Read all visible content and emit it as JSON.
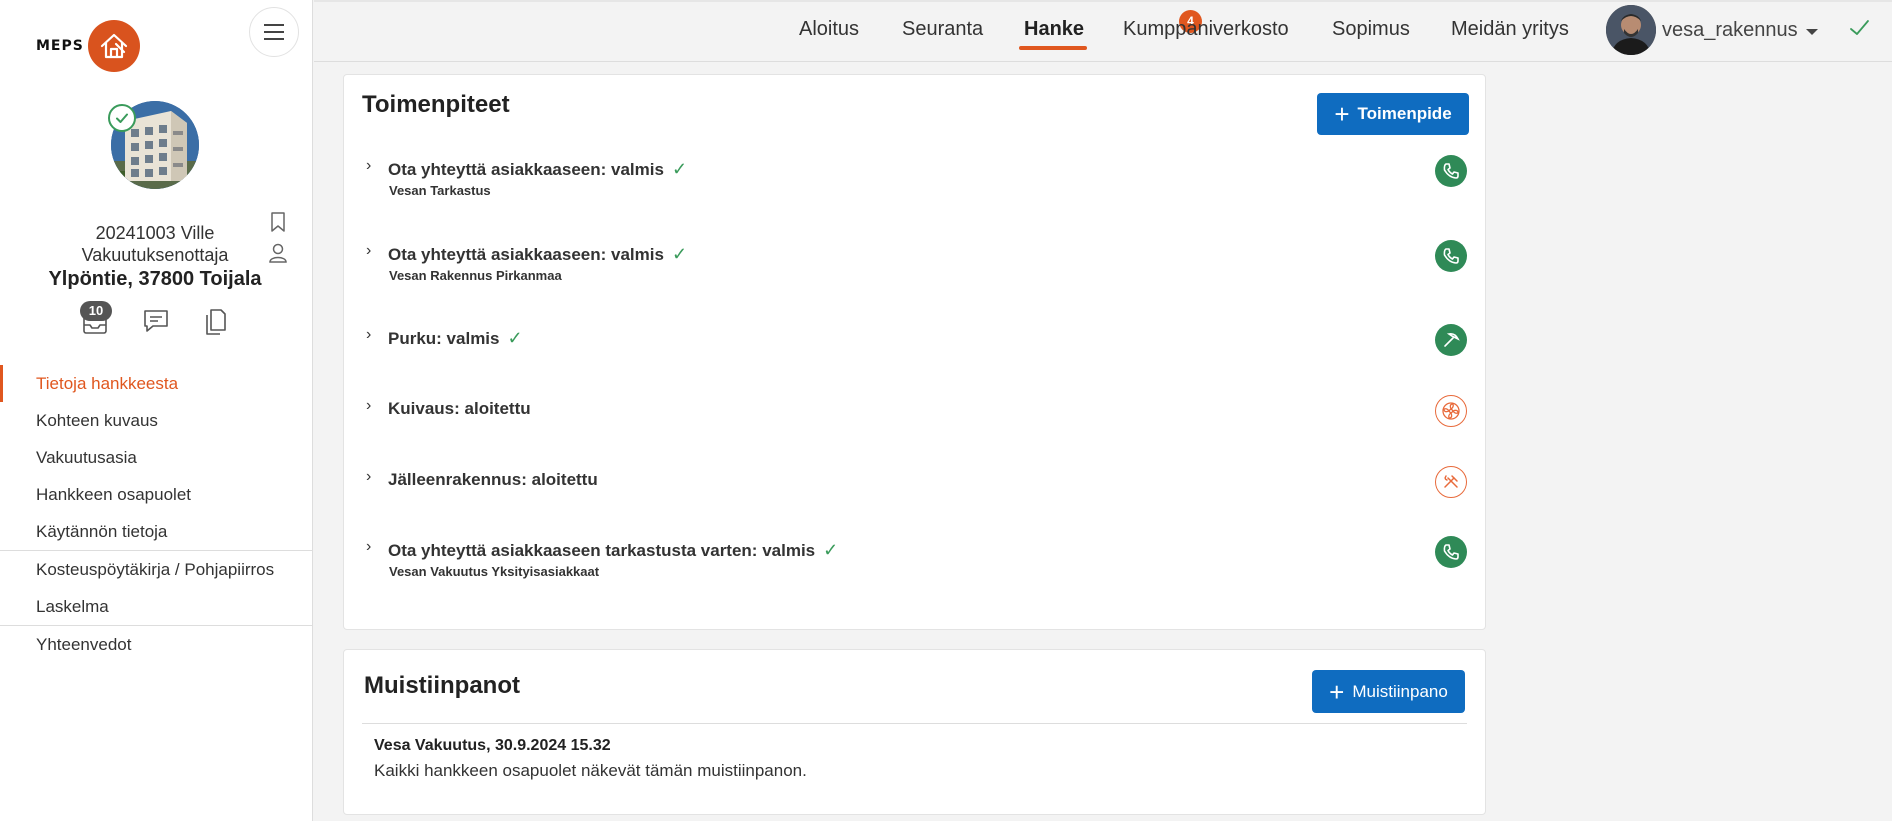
{
  "app": {
    "logo_text": "MEPS"
  },
  "project": {
    "id_name": "20241003 Ville",
    "role": "Vakuutuksenottaja",
    "address": "Ylpöntie, 37800 Toijala",
    "inbox_count": "10"
  },
  "sidebar": {
    "items": [
      {
        "label": "Tietoja hankkeesta",
        "active": true
      },
      {
        "label": "Kohteen kuvaus"
      },
      {
        "label": "Vakuutusasia"
      },
      {
        "label": "Hankkeen osapuolet"
      },
      {
        "label": "Käytännön tietoja"
      },
      {
        "label": "Kosteuspöytäkirja / Pohjapiirros"
      },
      {
        "label": "Laskelma"
      },
      {
        "label": "Yhteenvedot"
      }
    ]
  },
  "topnav": {
    "tabs": [
      "Aloitus",
      "Seuranta",
      "Hanke",
      "Kumppaniverkosto",
      "Sopimus",
      "Meidän yritys"
    ],
    "active_tab": "Hanke",
    "notification_count": "4",
    "username": "vesa_rakennus"
  },
  "actions": {
    "title": "Toimenpiteet",
    "add_label": "Toimenpide",
    "items": [
      {
        "title": "Ota yhteyttä asiakkaaseen: valmis",
        "subtitle": "Vesan Tarkastus",
        "done": true,
        "icon": "phone-icon",
        "status_color": "#2f8a57"
      },
      {
        "title": "Ota yhteyttä asiakkaaseen: valmis",
        "subtitle": "Vesan Rakennus Pirkanmaa",
        "done": true,
        "icon": "phone-icon",
        "status_color": "#2f8a57"
      },
      {
        "title": "Purku: valmis",
        "subtitle": "",
        "done": true,
        "icon": "pickaxe-icon",
        "status_color": "#2f8a57"
      },
      {
        "title": "Kuivaus: aloitettu",
        "subtitle": "",
        "done": false,
        "icon": "fan-icon",
        "status_color": "#e86a3b"
      },
      {
        "title": "Jälleenrakennus: aloitettu",
        "subtitle": "",
        "done": false,
        "icon": "tools-icon",
        "status_color": "#e86a3b"
      },
      {
        "title": "Ota yhteyttä asiakkaaseen tarkastusta varten: valmis",
        "subtitle": "Vesan Vakuutus Yksityisasiakkaat",
        "done": true,
        "icon": "phone-icon",
        "status_color": "#2f8a57"
      }
    ]
  },
  "notes": {
    "title": "Muistiinpanot",
    "add_label": "Muistiinpano",
    "items": [
      {
        "author": "Vesa Vakuutus, 30.9.2024 15.32",
        "text": "Kaikki hankkeen osapuolet näkevät tämän muistiinpanon."
      }
    ]
  },
  "colors": {
    "accent": "#e0571f",
    "primary_button": "#0f6cc0",
    "done_green": "#2f8a57",
    "in_progress_orange": "#e86a3b"
  }
}
